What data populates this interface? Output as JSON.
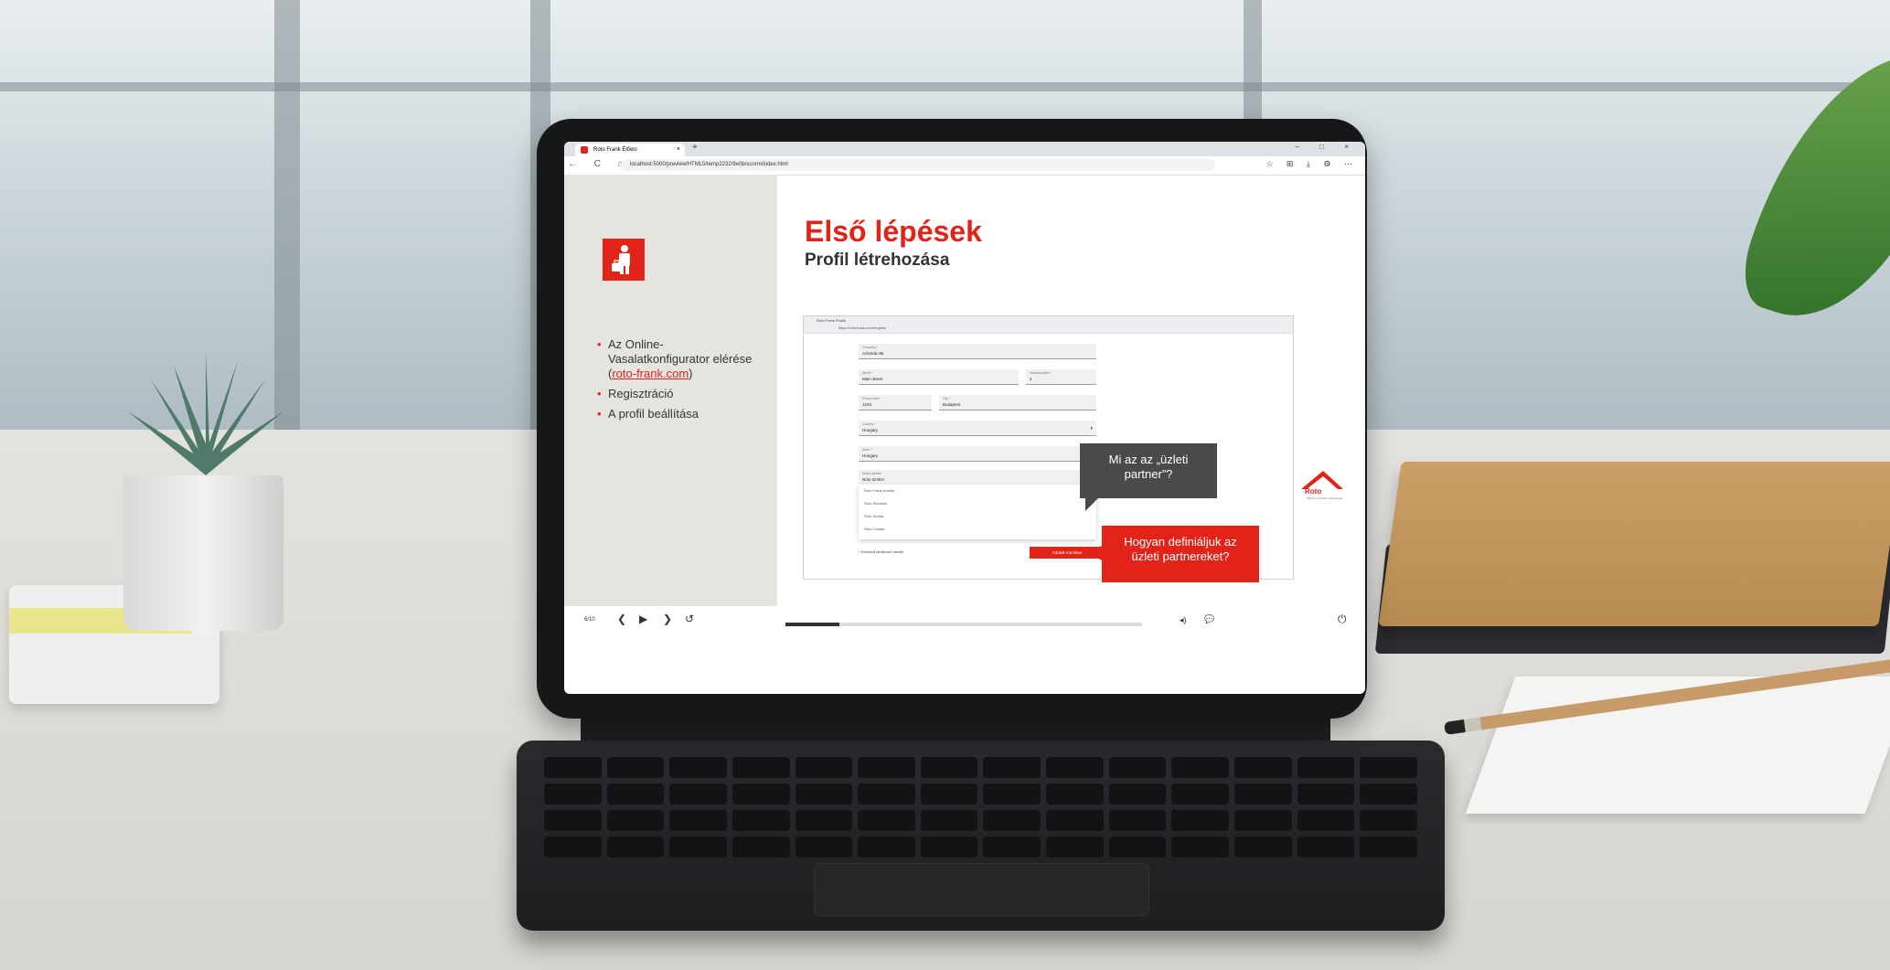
{
  "browser": {
    "tab_title": "Roto Frank Élőwo",
    "tab_close": "×",
    "new_tab": "+",
    "window_controls": "– □ ×",
    "nav_icons": "← C ⌂",
    "url": "localhost:5000/preview/HTML5/temp2232/9e0b/scorm/index.html",
    "toolbar_icons": "☆ ⊞ ⤓ ⚙ ⋯"
  },
  "slide": {
    "title": "Első lépések",
    "subtitle": "Profil létrehozása",
    "bullets": {
      "item1_text": "Az Online-Vasalatkonfigurator elérése",
      "item1_link": "roto-frank.com",
      "item2": "Regisztráció",
      "item3": "A profil beállítása"
    }
  },
  "inner_form": {
    "tab_title": "Roto Frank Profile",
    "url": "https://roto-frank.com/register",
    "fields": [
      {
        "label": "Company *",
        "value": "Azienda AB"
      },
      {
        "label": "Street *",
        "value": "Main street"
      },
      {
        "label": "Housenumber *",
        "value": "4"
      },
      {
        "label": "Postal code *",
        "value": "1234"
      },
      {
        "label": "City *",
        "value": "Budapest"
      },
      {
        "label": "Country *",
        "value": "Hungary"
      },
      {
        "label": "State *",
        "value": "Hungary"
      },
      {
        "label": "Sales partner",
        "value": "Roto GmbH"
      }
    ],
    "dropdown_items": [
      "Roto Frank Austria",
      "Roto Slovakia",
      "Roto Serbia",
      "Roto Croatia"
    ],
    "partner_note": "* Kötelező kitöltendő mezők",
    "next_button": "Adatok mentése"
  },
  "bubbles": {
    "grey": "Mi az az „üzleti partner”?",
    "red": "Hogyan definiáljuk az üzleti partnereket?"
  },
  "logo": {
    "name": "Roto",
    "tagline": "Window and Door Technology"
  },
  "player": {
    "page": "6/10",
    "prev": "❮",
    "play": "▶",
    "next": "❯",
    "replay": "↺",
    "volume": "◂)",
    "chat": "💬",
    "power": "⏻",
    "progress": 0.15
  },
  "colors": {
    "accent": "#e2231a",
    "bubble_grey": "#4a4a49",
    "panel": "#e6e4df"
  }
}
